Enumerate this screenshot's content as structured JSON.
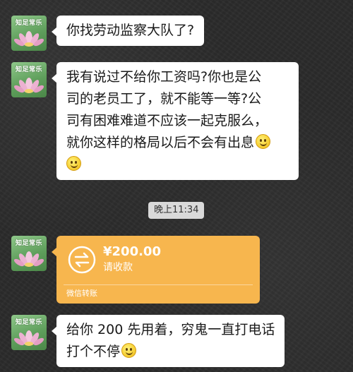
{
  "contact": {
    "avatar_label": "知足常乐"
  },
  "messages": [
    {
      "text": "你找劳动监察大队了?"
    },
    {
      "lines": [
        "我有说过不给你工资吗?你也是公",
        "司的老员工了，就不能等一等?公",
        "司有困难难道不应该一起克服么，",
        "就你这样的格局以后不会有出息"
      ],
      "emojis": [
        "smile-emoji",
        "smile-emoji"
      ]
    },
    {
      "lines": [
        "给你 200 先用着，穷鬼一直打电话",
        "打个不停"
      ],
      "emojis": [
        "smile-emoji"
      ]
    }
  ],
  "timestamp": "晚上11:34",
  "transfer": {
    "amount": "¥200.00",
    "status": "请收款",
    "footer": "微信转账",
    "color": "#f7b64e"
  }
}
